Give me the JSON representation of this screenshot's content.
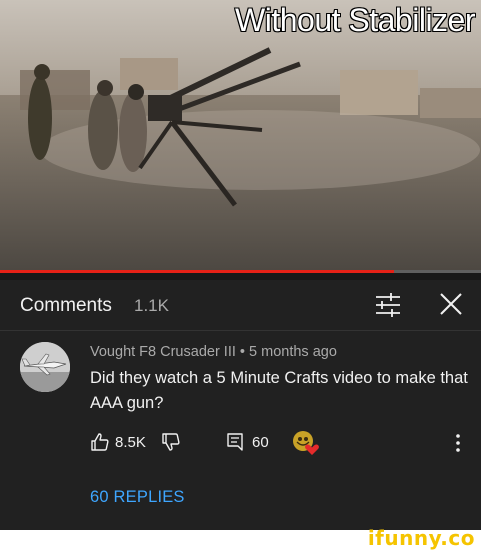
{
  "video": {
    "caption": "Without Stabilizer",
    "progress": 0.82
  },
  "comments_header": {
    "title": "Comments",
    "count": "1.1K",
    "sort_icon": "sort-sliders-icon",
    "close_icon": "close-icon"
  },
  "comment": {
    "author": "Vought F8 Crusader III",
    "age": "5 months ago",
    "meta": "Vought F8 Crusader III • 5 months ago",
    "text": "Did they watch a 5 Minute Crafts video to make that AAA gun?",
    "likes": "8.5K",
    "replies_count": "60",
    "replies_link": "60 REPLIES"
  },
  "icons": {
    "like": "thumbs-up-icon",
    "dislike": "thumbs-down-icon",
    "reply": "reply-comment-icon",
    "creator_heart": "creator-heart-icon",
    "more": "more-vertical-icon"
  },
  "colors": {
    "background": "#212121",
    "progress": "#e62117",
    "link": "#3ea6ff",
    "watermark": "#f5c400"
  },
  "watermark": "ifunny.co"
}
